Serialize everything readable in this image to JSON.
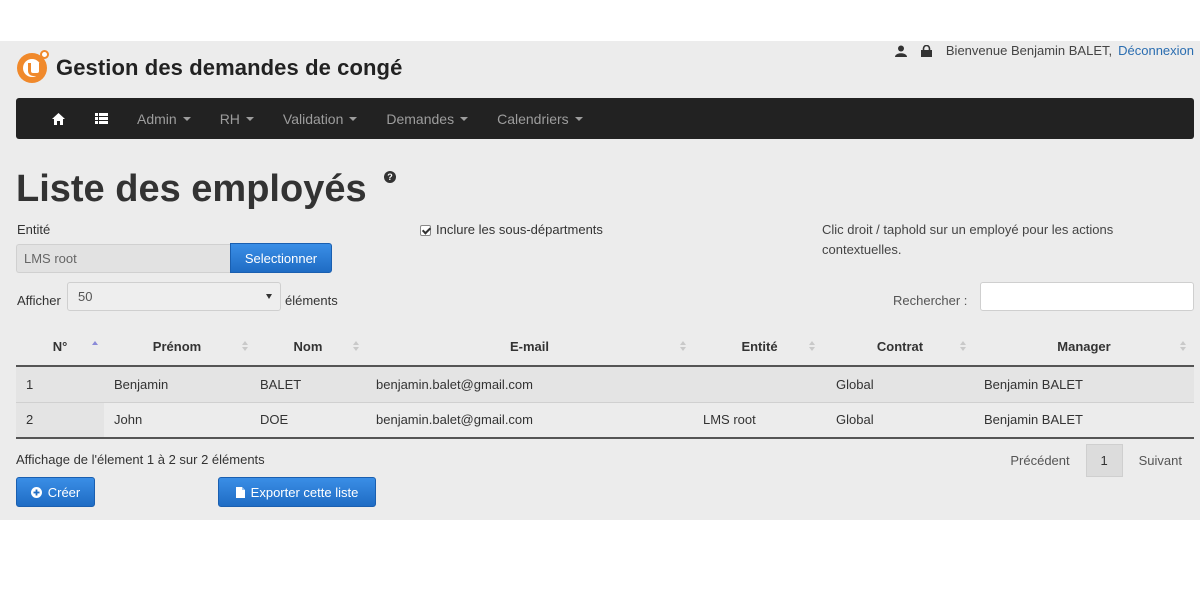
{
  "header": {
    "title": "Gestion des demandes de congé",
    "welcome": "Bienvenue Benjamin BALET,",
    "logout": "Déconnexion"
  },
  "navbar": {
    "items": [
      {
        "label": "Admin"
      },
      {
        "label": "RH"
      },
      {
        "label": "Validation"
      },
      {
        "label": "Demandes"
      },
      {
        "label": "Calendriers"
      }
    ]
  },
  "page": {
    "title": "Liste des employés",
    "help": "?"
  },
  "filters": {
    "entity_label": "Entité",
    "entity_value": "LMS root",
    "select_button": "Selectionner",
    "include_sub": "Inclure les sous-départments",
    "include_sub_checked": true,
    "context_hint": "Clic droit / taphold sur un employé pour les actions contextuelles.",
    "show_label": "Afficher",
    "show_value": "50",
    "elements_label": "éléments",
    "search_label": "Rechercher :",
    "search_value": ""
  },
  "table": {
    "columns": [
      "N°",
      "Prénom",
      "Nom",
      "E-mail",
      "Entité",
      "Contrat",
      "Manager"
    ],
    "rows": [
      {
        "num": "1",
        "firstname": "Benjamin",
        "lastname": "BALET",
        "email": "benjamin.balet@gmail.com",
        "entity": "",
        "contract": "Global",
        "manager": "Benjamin BALET"
      },
      {
        "num": "2",
        "firstname": "John",
        "lastname": "DOE",
        "email": "benjamin.balet@gmail.com",
        "entity": "LMS root",
        "contract": "Global",
        "manager": "Benjamin BALET"
      }
    ]
  },
  "footer": {
    "info": "Affichage de l'élement 1 à 2 sur 2 éléments",
    "previous": "Précédent",
    "page": "1",
    "next": "Suivant"
  },
  "actions": {
    "create": "Créer",
    "export": "Exporter cette liste"
  },
  "colors": {
    "navbar": "#222222",
    "primary": "#2f7ed8",
    "logo": "#f0892b"
  }
}
